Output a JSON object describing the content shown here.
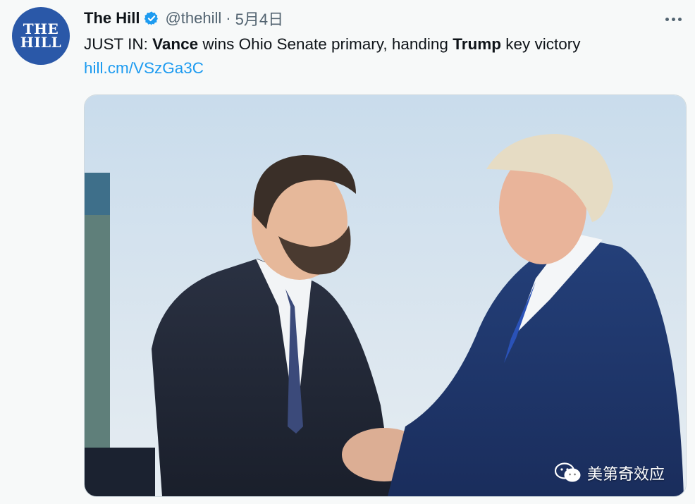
{
  "account": {
    "avatar_lines": [
      "THE",
      "HILL"
    ],
    "name": "The Hill",
    "handle": "@thehill",
    "separator": "·",
    "date": "5月4日"
  },
  "tweet": {
    "prefix": "JUST IN: ",
    "bold1": "Vance",
    "mid": " wins Ohio Senate primary, handing ",
    "bold2": "Trump",
    "suffix": " key victory",
    "link": "hill.cm/VSzGa3C"
  },
  "media": {
    "alt": "Vance shaking hands with Trump outdoors"
  },
  "watermark": {
    "text": "美第奇效应",
    "icon": "wechat-icon"
  },
  "icons": {
    "verified": "verified-badge-icon",
    "more": "more-options-icon"
  },
  "colors": {
    "link": "#1d9bf0",
    "verified": "#1d9bf0",
    "avatar": "#2a58a8"
  }
}
